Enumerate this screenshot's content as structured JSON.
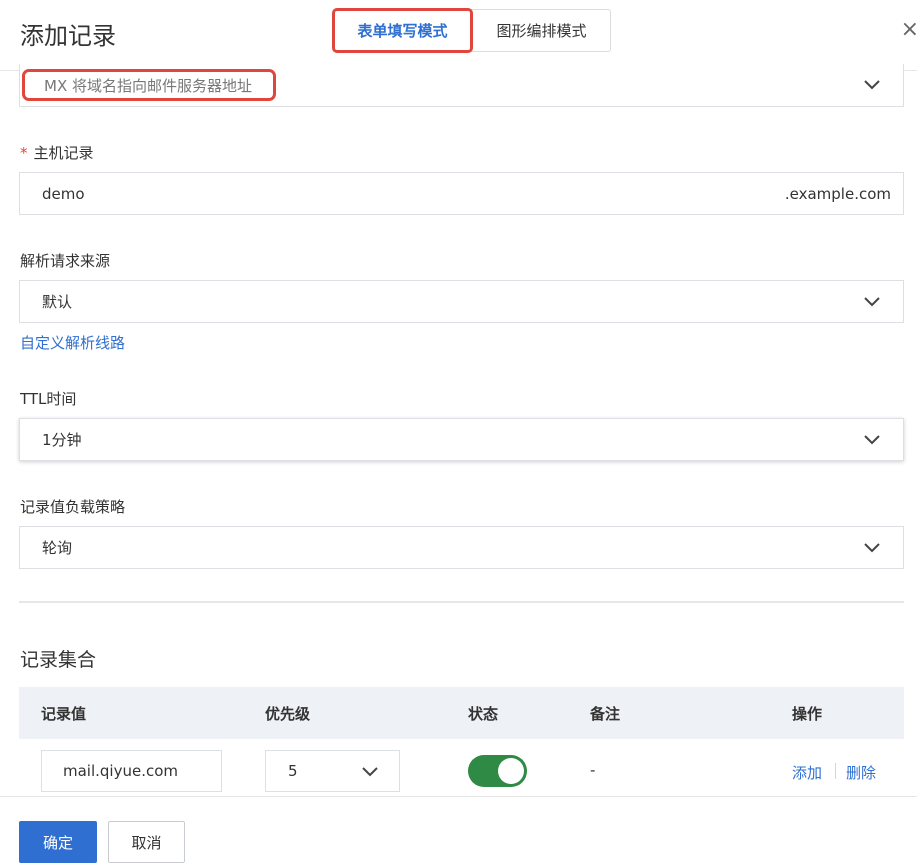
{
  "dialog": {
    "title": "添加记录",
    "close_glyph": "×"
  },
  "mode_switch": {
    "tabs": [
      {
        "label": "表单填写模式",
        "active": true
      },
      {
        "label": "图形编排模式",
        "active": false
      }
    ]
  },
  "record_type": {
    "value": "MX 将域名指向邮件服务器地址",
    "icon": "chevron-down-icon"
  },
  "host_record": {
    "label": "主机记录",
    "required_mark": "*",
    "value": "demo",
    "suffix": ".example.com"
  },
  "request_source": {
    "label": "解析请求来源",
    "value": "默认",
    "custom_link": "自定义解析线路"
  },
  "ttl": {
    "label": "TTL时间",
    "value": "1分钟"
  },
  "load_balance": {
    "label": "记录值负载策略",
    "value": "轮询"
  },
  "record_set": {
    "title": "记录集合",
    "columns": [
      "记录值",
      "优先级",
      "状态",
      "备注",
      "操作"
    ],
    "rows": [
      {
        "value": "mail.qiyue.com",
        "priority": "5",
        "enabled": true,
        "note": "-",
        "actions": [
          "添加",
          "删除"
        ]
      }
    ]
  },
  "footer": {
    "confirm_label": "确定",
    "cancel_label": "取消"
  },
  "colors": {
    "accent": "#2f6fd1",
    "highlight_border": "#e0463c",
    "toggle_on": "#2e8a45"
  }
}
